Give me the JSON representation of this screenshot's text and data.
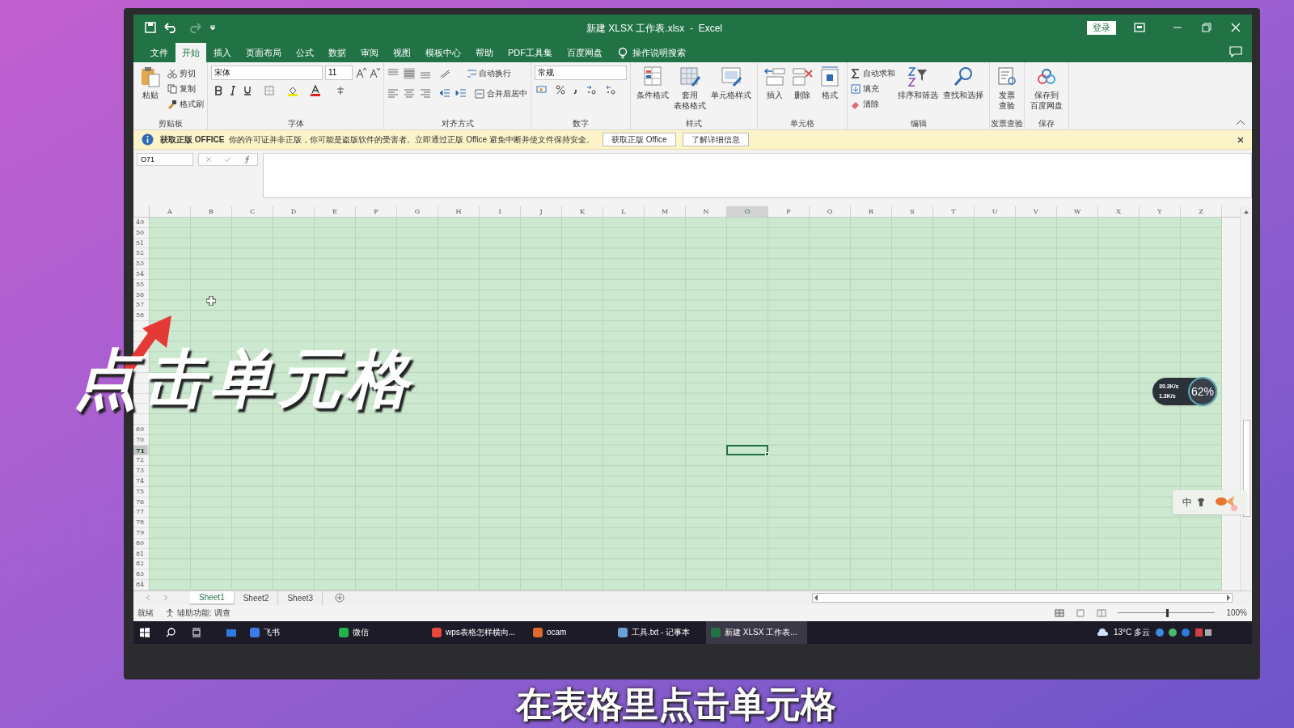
{
  "window": {
    "title": "新建 XLSX 工作表.xlsx  -  Excel",
    "login_button": "登录"
  },
  "menu_tabs": [
    {
      "label": "文件",
      "selected": false
    },
    {
      "label": "开始",
      "selected": true
    },
    {
      "label": "插入",
      "selected": false
    },
    {
      "label": "页面布局",
      "selected": false
    },
    {
      "label": "公式",
      "selected": false
    },
    {
      "label": "数据",
      "selected": false
    },
    {
      "label": "审阅",
      "selected": false
    },
    {
      "label": "视图",
      "selected": false
    },
    {
      "label": "模板中心",
      "selected": false
    },
    {
      "label": "帮助",
      "selected": false
    },
    {
      "label": "PDF工具集",
      "selected": false
    },
    {
      "label": "百度网盘",
      "selected": false
    }
  ],
  "tell_me": "操作说明搜索",
  "ribbon": {
    "clipboard": {
      "paste": "粘贴",
      "cut": "剪切",
      "copy": "复制",
      "painter": "格式刷",
      "label": "剪贴板"
    },
    "font": {
      "font_name": "宋体",
      "font_size": "11",
      "label": "字体"
    },
    "alignment": {
      "wrap": "自动换行",
      "merge": "合并后居中",
      "label": "对齐方式"
    },
    "number": {
      "format": "常规",
      "label": "数字"
    },
    "styles": {
      "buttons": [
        {
          "lines": [
            "条件格式"
          ]
        },
        {
          "lines": [
            "套用",
            "表格格式"
          ]
        },
        {
          "lines": [
            "单元格样式"
          ]
        }
      ],
      "label": "样式"
    },
    "cells": {
      "buttons": [
        "插入",
        "删除",
        "格式"
      ],
      "label": "单元格"
    },
    "editing": {
      "autosum": "自动求和",
      "fill": "填充",
      "clear": "清除",
      "sort": "排序和筛选",
      "find": "查找和选择",
      "label": "编辑"
    },
    "invoice": {
      "lines": [
        "发票",
        "查验"
      ],
      "label": "发票查验"
    },
    "save": {
      "lines": [
        "保存到",
        "百度网盘"
      ],
      "label": "保存"
    }
  },
  "info_bar": {
    "title": "获取正版 OFFICE",
    "message": "你的许可证并非正版，你可能是盗版软件的受害者。立即通过正版 Office 避免中断并使文件保持安全。",
    "buttons": [
      "获取正版 Office",
      "了解详细信息"
    ]
  },
  "name_box": "O71",
  "columns": [
    {
      "label": "A",
      "selected": false
    },
    {
      "label": "B",
      "selected": false
    },
    {
      "label": "C",
      "selected": false
    },
    {
      "label": "D",
      "selected": false
    },
    {
      "label": "E",
      "selected": false
    },
    {
      "label": "F",
      "selected": false
    },
    {
      "label": "G",
      "selected": false
    },
    {
      "label": "H",
      "selected": false
    },
    {
      "label": "I",
      "selected": false
    },
    {
      "label": "J",
      "selected": false
    },
    {
      "label": "K",
      "selected": false
    },
    {
      "label": "L",
      "selected": false
    },
    {
      "label": "M",
      "selected": false
    },
    {
      "label": "N",
      "selected": false
    },
    {
      "label": "O",
      "selected": true
    },
    {
      "label": "P",
      "selected": false
    },
    {
      "label": "Q",
      "selected": false
    },
    {
      "label": "R",
      "selected": false
    },
    {
      "label": "S",
      "selected": false
    },
    {
      "label": "T",
      "selected": false
    },
    {
      "label": "U",
      "selected": false
    },
    {
      "label": "V",
      "selected": false
    },
    {
      "label": "W",
      "selected": false
    },
    {
      "label": "X",
      "selected": false
    },
    {
      "label": "Y",
      "selected": false
    },
    {
      "label": "Z",
      "selected": false
    }
  ],
  "rows": [
    {
      "label": "49",
      "selected": false
    },
    {
      "label": "50",
      "selected": false
    },
    {
      "label": "51",
      "selected": false
    },
    {
      "label": "52",
      "selected": false
    },
    {
      "label": "53",
      "selected": false
    },
    {
      "label": "54",
      "selected": false
    },
    {
      "label": "55",
      "selected": false
    },
    {
      "label": "56",
      "selected": false
    },
    {
      "label": "57",
      "selected": false
    },
    {
      "label": "58",
      "selected": false
    },
    {
      "selected": false
    },
    {
      "selected": false
    },
    {
      "selected": false
    },
    {
      "selected": false
    },
    {
      "selected": false
    },
    {
      "selected": false
    },
    {
      "selected": false
    },
    {
      "selected": false
    },
    {
      "selected": false
    },
    {
      "selected": false
    },
    {
      "label": "69",
      "selected": false
    },
    {
      "label": "70",
      "selected": false
    },
    {
      "label": "71",
      "selected": true
    },
    {
      "label": "72",
      "selected": false
    },
    {
      "label": "73",
      "selected": false
    },
    {
      "label": "74",
      "selected": false
    },
    {
      "label": "75",
      "selected": false
    },
    {
      "label": "76",
      "selected": false
    },
    {
      "label": "77",
      "selected": false
    },
    {
      "label": "78",
      "selected": false
    },
    {
      "label": "79",
      "selected": false
    },
    {
      "label": "80",
      "selected": false
    },
    {
      "label": "81",
      "selected": false
    },
    {
      "label": "82",
      "selected": false
    },
    {
      "label": "83",
      "selected": false
    },
    {
      "label": "84",
      "selected": false
    }
  ],
  "sheet_tabs": [
    {
      "label": "Sheet1",
      "selected": true
    },
    {
      "label": "Sheet2",
      "selected": false
    },
    {
      "label": "Sheet3",
      "selected": false
    }
  ],
  "status_bar": {
    "ready": "就绪",
    "accessibility": "辅助功能: 调查",
    "zoom": "100%",
    "zoom_level": {
      "level": 0.5
    }
  },
  "taskbar": {
    "apps": [
      {
        "label": "飞书",
        "selected": false
      },
      {
        "label": "微信",
        "selected": false
      },
      {
        "label": "wps表格怎样横向...",
        "selected": false
      },
      {
        "label": "ocam",
        "selected": false
      },
      {
        "label": "工具.txt - 记事本",
        "selected": false
      },
      {
        "label": "新建 XLSX 工作表...",
        "selected": true
      }
    ],
    "weather": "13°C 多云"
  },
  "network_widget": {
    "upload": "30.3K/s",
    "download": "1.3K/s",
    "percent": "62%"
  },
  "ime_widget": {
    "mode": "中"
  },
  "overlay_caption": "点击单元格",
  "subtitle": "在表格里点击单元格"
}
